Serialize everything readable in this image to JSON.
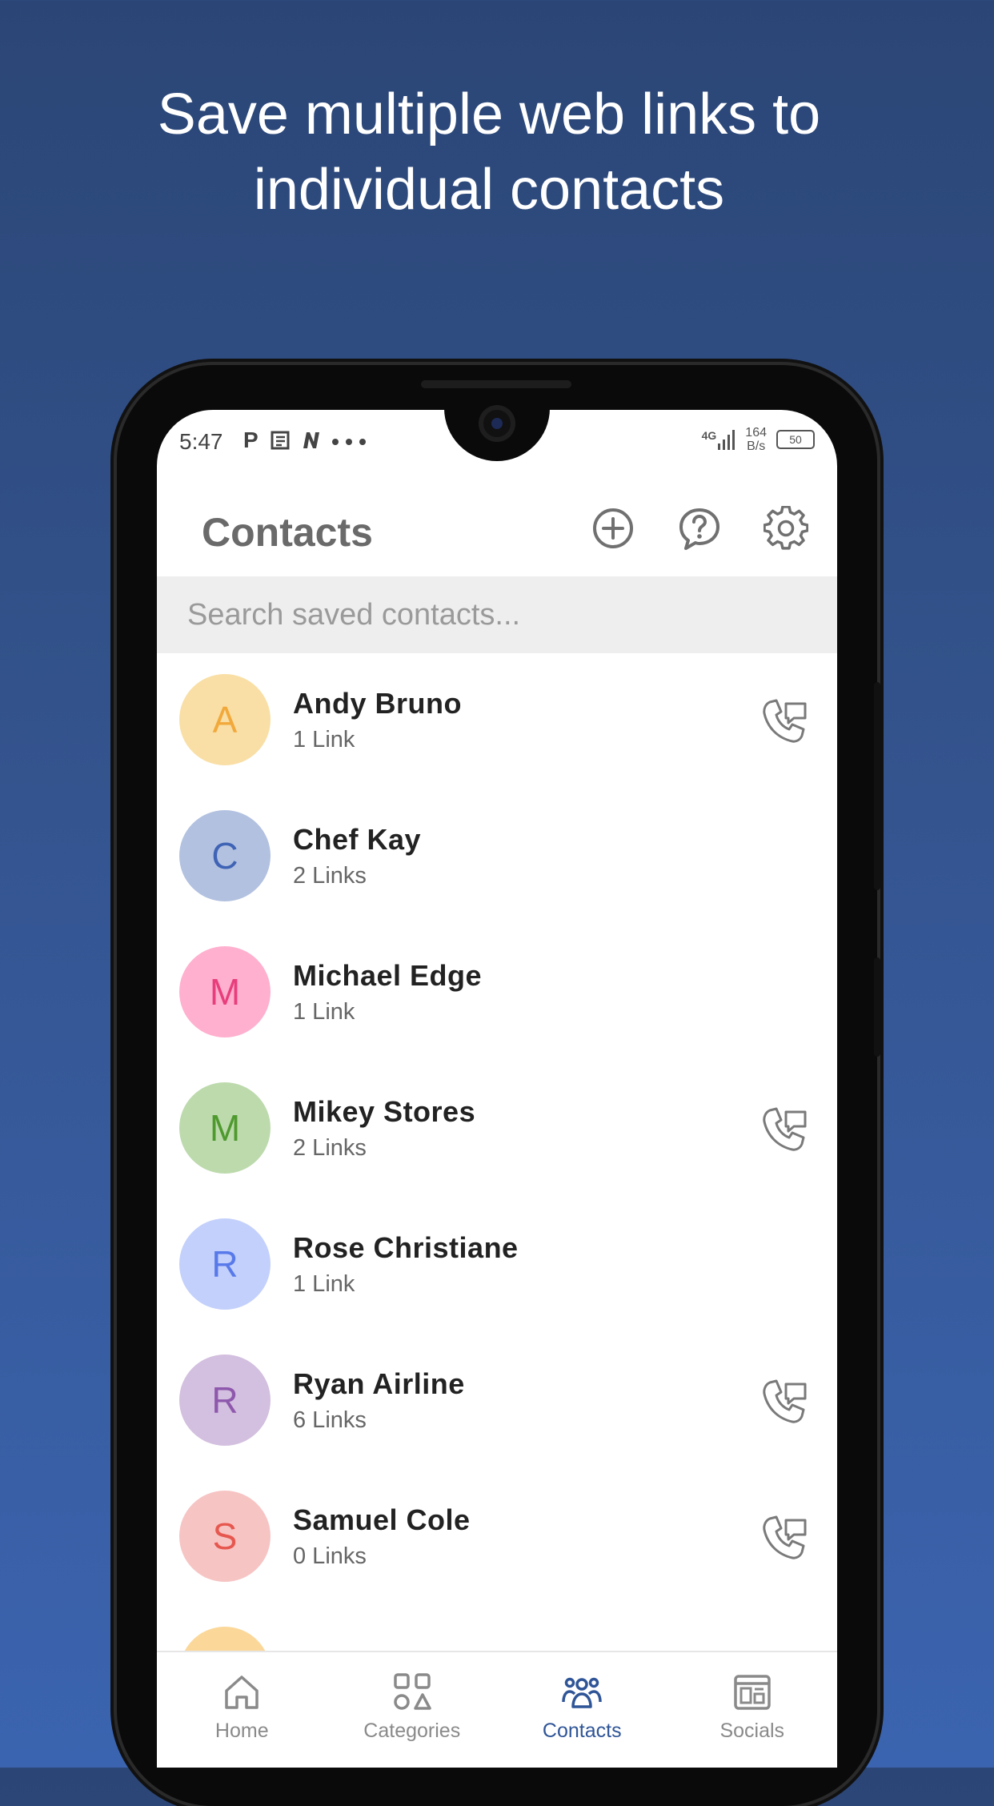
{
  "headline": {
    "line1": "Save multiple web links to",
    "line2": "individual contacts"
  },
  "status_bar": {
    "time": "5:47",
    "app_icons": "P",
    "network": "4G",
    "speed_value": "164",
    "speed_unit": "B/s",
    "battery": "50"
  },
  "header": {
    "title": "Contacts",
    "icons": [
      "add-circle-icon",
      "help-chat-icon",
      "settings-gear-icon"
    ]
  },
  "search": {
    "placeholder": "Search saved contacts..."
  },
  "contacts": [
    {
      "initial": "A",
      "name": "Andy Bruno",
      "links": "1 Link",
      "bg": "#f9dfa6",
      "fg": "#f2a93b",
      "call": true
    },
    {
      "initial": "C",
      "name": "Chef Kay",
      "links": "2 Links",
      "bg": "#b2c1e0",
      "fg": "#3f63b5",
      "call": false
    },
    {
      "initial": "M",
      "name": "Michael Edge",
      "links": "1 Link",
      "bg": "#ffb0cf",
      "fg": "#e83f7c",
      "call": false
    },
    {
      "initial": "M",
      "name": "Mikey Stores",
      "links": "2 Links",
      "bg": "#bddaad",
      "fg": "#4f9a2f",
      "call": true
    },
    {
      "initial": "R",
      "name": "Rose Christiane",
      "links": "1 Link",
      "bg": "#c3d0fb",
      "fg": "#5879ea",
      "call": false
    },
    {
      "initial": "R",
      "name": "Ryan Airline",
      "links": "6 Links",
      "bg": "#d3bfdf",
      "fg": "#8e58ad",
      "call": true
    },
    {
      "initial": "S",
      "name": "Samuel Cole",
      "links": "0 Links",
      "bg": "#f7c4c4",
      "fg": "#e6584f",
      "call": true
    }
  ],
  "nav": [
    {
      "label": "Home",
      "icon": "home-icon",
      "active": false
    },
    {
      "label": "Categories",
      "icon": "categories-icon",
      "active": false
    },
    {
      "label": "Contacts",
      "icon": "contacts-icon",
      "active": true
    },
    {
      "label": "Socials",
      "icon": "socials-icon",
      "active": false
    }
  ],
  "colors": {
    "accent": "#2f5597",
    "icon_gray": "#7a7a7a",
    "search_bg": "#eeeeee"
  }
}
